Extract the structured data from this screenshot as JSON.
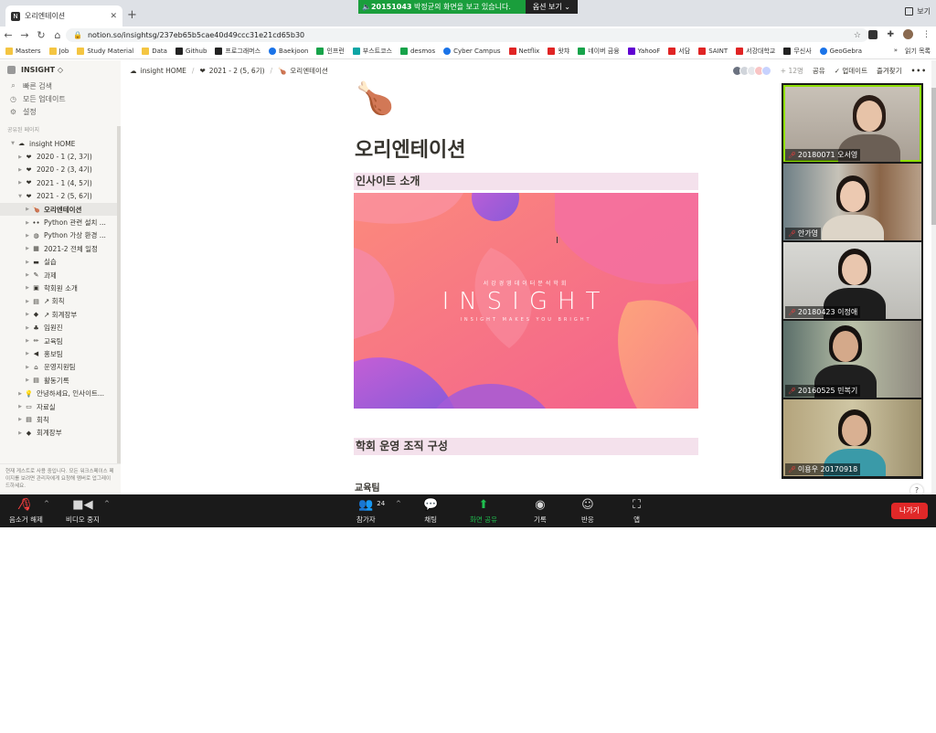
{
  "browser": {
    "tab_title": "오리엔테이션",
    "url": "notion.so/insightsg/237eb65b5cae40d49ccc31e21cd65b30",
    "share_banner": {
      "presenter_id": "20151043",
      "message": "박정균의 화면을 보고 있습니다.",
      "option_label": "옵션 보기 ⌄"
    },
    "window_right_label": "보기",
    "bookmarks": [
      {
        "label": "Masters",
        "icon": "folder"
      },
      {
        "label": "Job",
        "icon": "folder"
      },
      {
        "label": "Study Material",
        "icon": "folder"
      },
      {
        "label": "Data",
        "icon": "folder"
      },
      {
        "label": "Github",
        "icon": "dark"
      },
      {
        "label": "프로그래머스",
        "icon": "dark"
      },
      {
        "label": "Baekjoon",
        "icon": "blue"
      },
      {
        "label": "인프런",
        "icon": "green"
      },
      {
        "label": "부스트코스",
        "icon": "teal"
      },
      {
        "label": "desmos",
        "icon": "green"
      },
      {
        "label": "Cyber Campus",
        "icon": "blue"
      },
      {
        "label": "Netflix",
        "icon": "red"
      },
      {
        "label": "왓챠",
        "icon": "red"
      },
      {
        "label": "네이버 금융",
        "icon": "green"
      },
      {
        "label": "YahooF",
        "icon": "purple"
      },
      {
        "label": "서담",
        "icon": "red"
      },
      {
        "label": "SAINT",
        "icon": "red"
      },
      {
        "label": "서강대학교",
        "icon": "red"
      },
      {
        "label": "무신사",
        "icon": "dark"
      },
      {
        "label": "GeoGebra",
        "icon": "blue"
      }
    ],
    "bookmarks_overflow": "»",
    "reading_list": "읽기 목록"
  },
  "sidebar": {
    "workspace": "INSIGHT ◇",
    "links": [
      {
        "label": "빠른 검색",
        "icon": "search-icon",
        "glyph": "⌕"
      },
      {
        "label": "모든 업데이트",
        "icon": "clock-icon",
        "glyph": "◷"
      },
      {
        "label": "설정",
        "icon": "gear-icon",
        "glyph": "⚙"
      }
    ],
    "shared_label": "공유된 페이지",
    "tree": [
      {
        "label": "insight HOME",
        "indent": 0,
        "toggle": "▼",
        "icon": "☁",
        "selected": false
      },
      {
        "label": "2020 - 1 (2, 3기)",
        "indent": 1,
        "toggle": "▶",
        "icon": "❤",
        "selected": false
      },
      {
        "label": "2020 - 2 (3, 4기)",
        "indent": 1,
        "toggle": "▶",
        "icon": "❤",
        "selected": false
      },
      {
        "label": "2021 - 1 (4, 5기)",
        "indent": 1,
        "toggle": "▶",
        "icon": "❤",
        "selected": false
      },
      {
        "label": "2021 - 2 (5, 6기)",
        "indent": 1,
        "toggle": "▼",
        "icon": "❤",
        "selected": false
      },
      {
        "label": "오리엔테이션",
        "indent": 2,
        "toggle": "▶",
        "icon": "🍗",
        "selected": true
      },
      {
        "label": "Python 관련 설치 ...",
        "indent": 2,
        "toggle": "▶",
        "icon": "••",
        "selected": false
      },
      {
        "label": "Python 가상 환경 ...",
        "indent": 2,
        "toggle": "▶",
        "icon": "◍",
        "selected": false
      },
      {
        "label": "2021-2 전체 일정",
        "indent": 2,
        "toggle": "▶",
        "icon": "▦",
        "selected": false
      },
      {
        "label": "실습",
        "indent": 2,
        "toggle": "▶",
        "icon": "▬",
        "selected": false
      },
      {
        "label": "과제",
        "indent": 2,
        "toggle": "▶",
        "icon": "✎",
        "selected": false
      },
      {
        "label": "학회원 소개",
        "indent": 2,
        "toggle": "▶",
        "icon": "▣",
        "selected": false
      },
      {
        "label": "↗ 회칙",
        "indent": 2,
        "toggle": "▶",
        "icon": "▤",
        "selected": false
      },
      {
        "label": "↗ 회계장부",
        "indent": 2,
        "toggle": "▶",
        "icon": "◆",
        "selected": false
      },
      {
        "label": "임원진",
        "indent": 2,
        "toggle": "▶",
        "icon": "♣",
        "selected": false
      },
      {
        "label": "교육팀",
        "indent": 2,
        "toggle": "▶",
        "icon": "✏",
        "selected": false
      },
      {
        "label": "홍보팀",
        "indent": 2,
        "toggle": "▶",
        "icon": "◀",
        "selected": false
      },
      {
        "label": "운영지원팀",
        "indent": 2,
        "toggle": "▶",
        "icon": "⌂",
        "selected": false
      },
      {
        "label": "활동기록",
        "indent": 2,
        "toggle": "▶",
        "icon": "▤",
        "selected": false
      },
      {
        "label": "안녕하세요, 인사이트...",
        "indent": 1,
        "toggle": "▶",
        "icon": "💡",
        "selected": false
      },
      {
        "label": "자료실",
        "indent": 1,
        "toggle": "▶",
        "icon": "▭",
        "selected": false
      },
      {
        "label": "회칙",
        "indent": 1,
        "toggle": "▶",
        "icon": "▤",
        "selected": false
      },
      {
        "label": "회계장부",
        "indent": 1,
        "toggle": "▶",
        "icon": "◆",
        "selected": false
      }
    ],
    "footer": "현재 게스트로 사용 중입니다. 모든 워크스페이스 페이지를 보려면 관리자에게 요청해 멤버로 업그레이드하세요."
  },
  "notion": {
    "breadcrumbs": [
      {
        "label": "insight HOME",
        "icon": "☁"
      },
      {
        "label": "2021 - 2 (5, 6기)",
        "icon": "❤"
      },
      {
        "label": "오리엔테이션",
        "icon": "🍗"
      }
    ],
    "topbar": {
      "more_users": "+ 12명",
      "share": "공유",
      "updates": "✓ 업데이트",
      "favorite": "즐겨찾기",
      "more": "•••"
    },
    "page_icon": "🍗",
    "page_title": "오리엔테이션",
    "section1": "인사이트 소개",
    "banner": {
      "kicker": "서강경영데이터분석학회",
      "title": "INSIGHT",
      "slogan": "INSIGHT MAKES YOU BRIGHT"
    },
    "section2": "학회 운영 조직 구성",
    "sub_heading": "교육팀",
    "help": "?"
  },
  "participants": [
    {
      "name": "20180071 오서영",
      "active": true
    },
    {
      "name": "안가영",
      "active": false
    },
    {
      "name": "20180423 이정애",
      "active": false
    },
    {
      "name": "20160525 민복기",
      "active": false
    },
    {
      "name": "이용우 20170918",
      "active": false
    }
  ],
  "zoom": {
    "mute": "음소거 해제",
    "video": "비디오 중지",
    "participants": "참가자",
    "participant_count": "24",
    "chat": "채팅",
    "share": "화면 공유",
    "record": "기록",
    "reactions": "반응",
    "apps": "앱",
    "leave": "나가기"
  },
  "colors": {
    "share_green": "#1a9e3c",
    "leave_red": "#e02828",
    "heading_bg": "#f4e1ec",
    "banner_pink": "#f66d8a",
    "banner_purple": "#8b5cd6",
    "speaker_outline": "#8ee000"
  }
}
